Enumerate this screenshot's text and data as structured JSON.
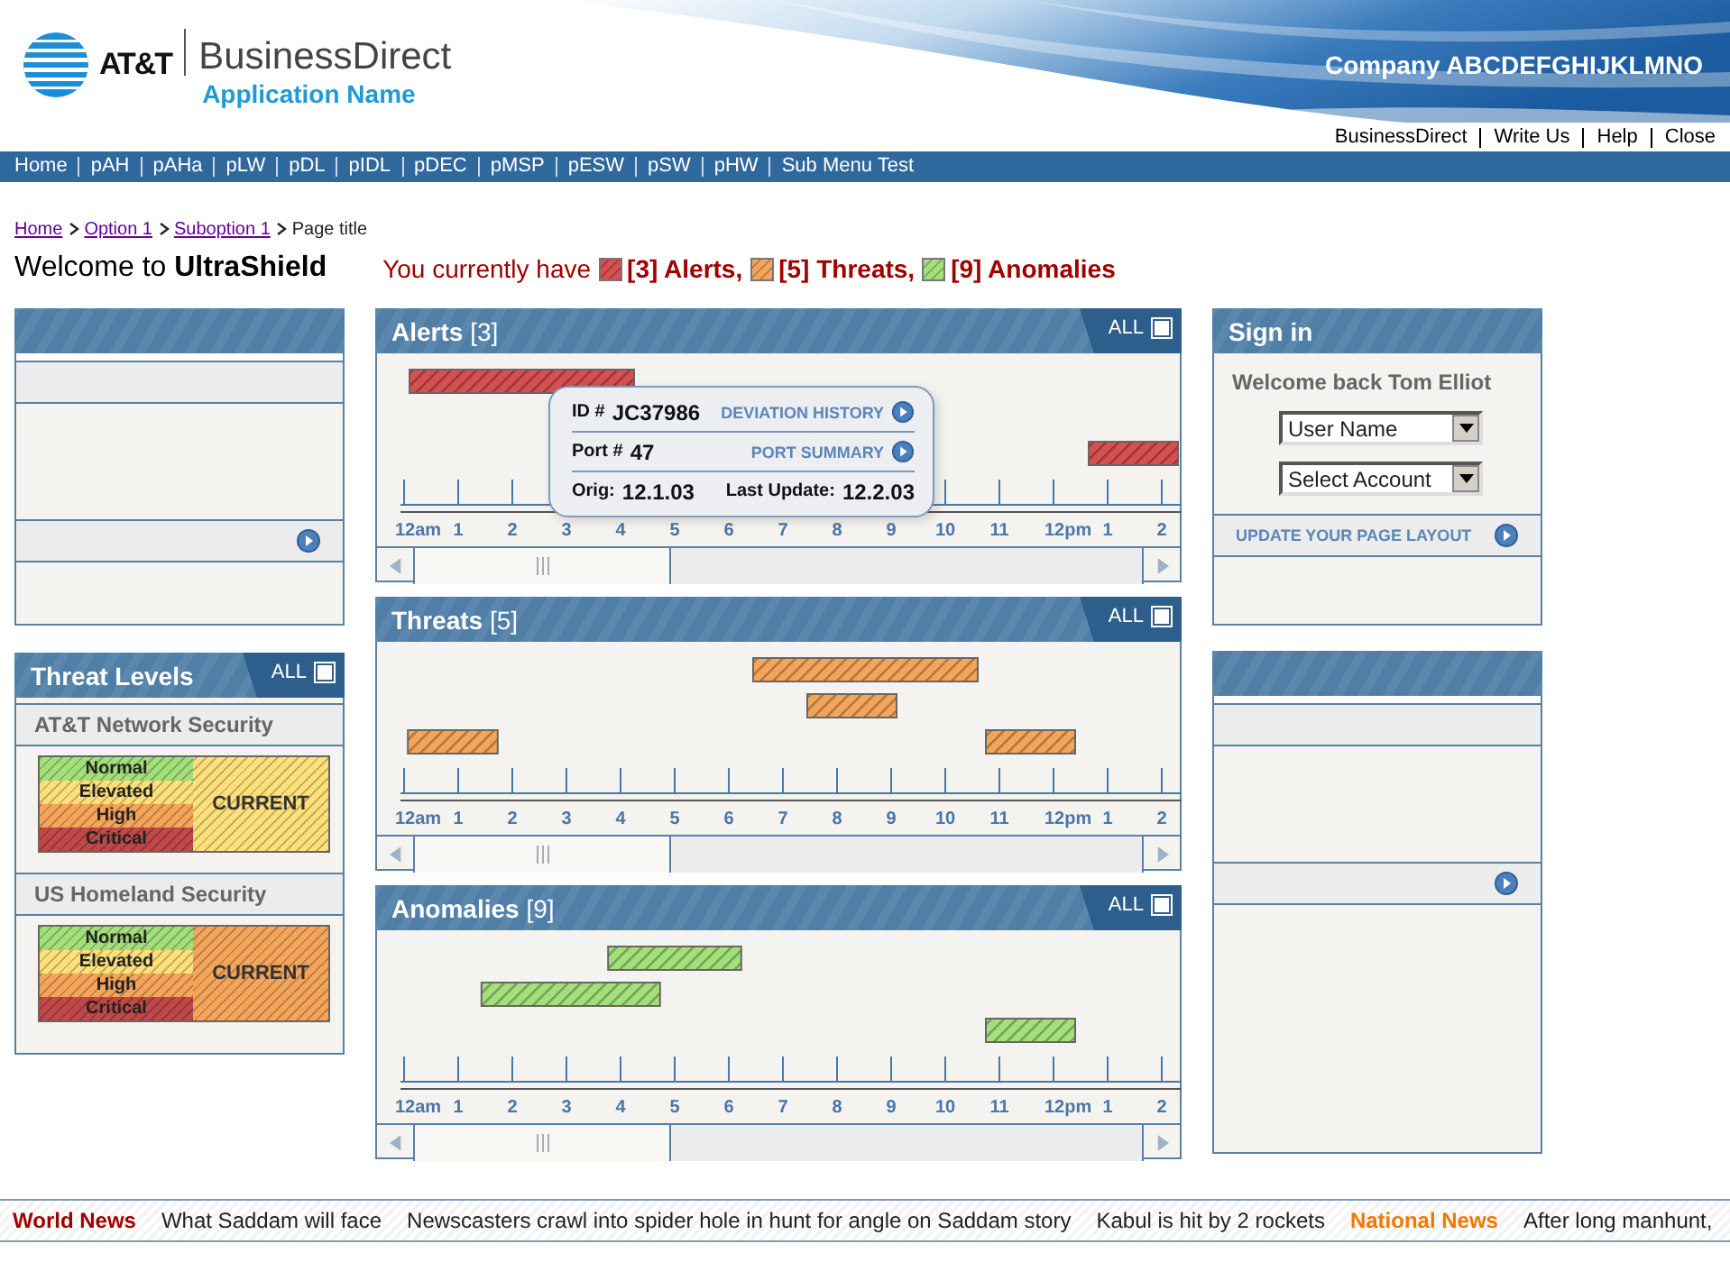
{
  "header": {
    "brand": "AT&T",
    "product": "BusinessDirect",
    "app_name": "Application Name",
    "company": "Company ABCDEFGHIJKLMNO"
  },
  "top_links": [
    "BusinessDirect",
    "Write Us",
    "Help",
    "Close"
  ],
  "nav": [
    "Home",
    "pAH",
    "pAHa",
    "pLW",
    "pDL",
    "pIDL",
    "pDEC",
    "pMSP",
    "pESW",
    "pSW",
    "pHW",
    "Sub Menu Test"
  ],
  "breadcrumb": {
    "links": [
      "Home",
      "Option 1",
      "Suboption 1"
    ],
    "current": "Page title"
  },
  "welcome": "Welcome to **UltraShield**",
  "summary": {
    "lead": "You currently have",
    "items": [
      {
        "label": "[3] Alerts,",
        "color": "#d65050"
      },
      {
        "label": "[5] Threats,",
        "color": "#f5a55a"
      },
      {
        "label": "[9] Anomalies",
        "color": "#a3e07a"
      }
    ]
  },
  "threat_levels": {
    "title": "Threat Levels",
    "all_label": "ALL",
    "all_checked": false,
    "sections": [
      {
        "name": "AT&T Network Security",
        "current": {
          "label": "CURRENT",
          "color": "#fde07a"
        },
        "levels": [
          {
            "label": "Normal",
            "color": "#a3e07a"
          },
          {
            "label": "Elevated",
            "color": "#fde07a"
          },
          {
            "label": "High",
            "color": "#f5a55a"
          },
          {
            "label": "Critical",
            "color": "#c04848"
          }
        ]
      },
      {
        "name": "US Homeland Security",
        "current": {
          "label": "CURRENT",
          "color": "#f5a55a"
        },
        "levels": [
          {
            "label": "Normal",
            "color": "#a3e07a"
          },
          {
            "label": "Elevated",
            "color": "#fde07a"
          },
          {
            "label": "High",
            "color": "#f5a55a"
          },
          {
            "label": "Critical",
            "color": "#c04848"
          }
        ]
      }
    ]
  },
  "timelines": [
    {
      "title": "Alerts",
      "count": "[3]",
      "all_label": "ALL",
      "all_checked": false,
      "color": "#d65050",
      "axis_labels": [
        "12am",
        "1",
        "2",
        "3",
        "4",
        "5",
        "6",
        "7",
        "8",
        "9",
        "10",
        "11",
        "12pm",
        "1",
        "2"
      ],
      "tooltip": {
        "id_label": "ID #",
        "id": "JC37986",
        "history_link": "DEVIATION HISTORY",
        "port_label": "Port #",
        "port": "47",
        "port_link": "PORT SUMMARY",
        "orig_label": "Orig:",
        "orig": "12.1.03",
        "update_label": "Last Update:",
        "update": "12.2.03"
      }
    },
    {
      "title": "Threats",
      "count": "[5]",
      "all_label": "ALL",
      "all_checked": false,
      "color": "#f5a55a",
      "axis_labels": [
        "12am",
        "1",
        "2",
        "3",
        "4",
        "5",
        "6",
        "7",
        "8",
        "9",
        "10",
        "11",
        "12pm",
        "1",
        "2"
      ]
    },
    {
      "title": "Anomalies",
      "count": "[9]",
      "all_label": "ALL",
      "all_checked": false,
      "color": "#a3e07a",
      "axis_labels": [
        "12am",
        "1",
        "2",
        "3",
        "4",
        "5",
        "6",
        "7",
        "8",
        "9",
        "10",
        "11",
        "12pm",
        "1",
        "2"
      ]
    }
  ],
  "sign_in": {
    "title": "Sign in",
    "greeting": "Welcome back Tom Elliot",
    "selects": [
      "User Name",
      "Select Account"
    ],
    "link": "UPDATE YOUR PAGE LAYOUT"
  },
  "ticker": [
    {
      "kind": "heading",
      "text": "World News",
      "color": "#a00000"
    },
    {
      "kind": "story",
      "text": "What Saddam will face"
    },
    {
      "kind": "story",
      "text": "Newscasters crawl into spider hole in hunt for angle on Saddam story"
    },
    {
      "kind": "story",
      "text": "Kabul is hit by 2 rockets"
    },
    {
      "kind": "heading",
      "text": "National News",
      "color": "#f07800"
    },
    {
      "kind": "story",
      "text": "After long manhunt,"
    }
  ]
}
